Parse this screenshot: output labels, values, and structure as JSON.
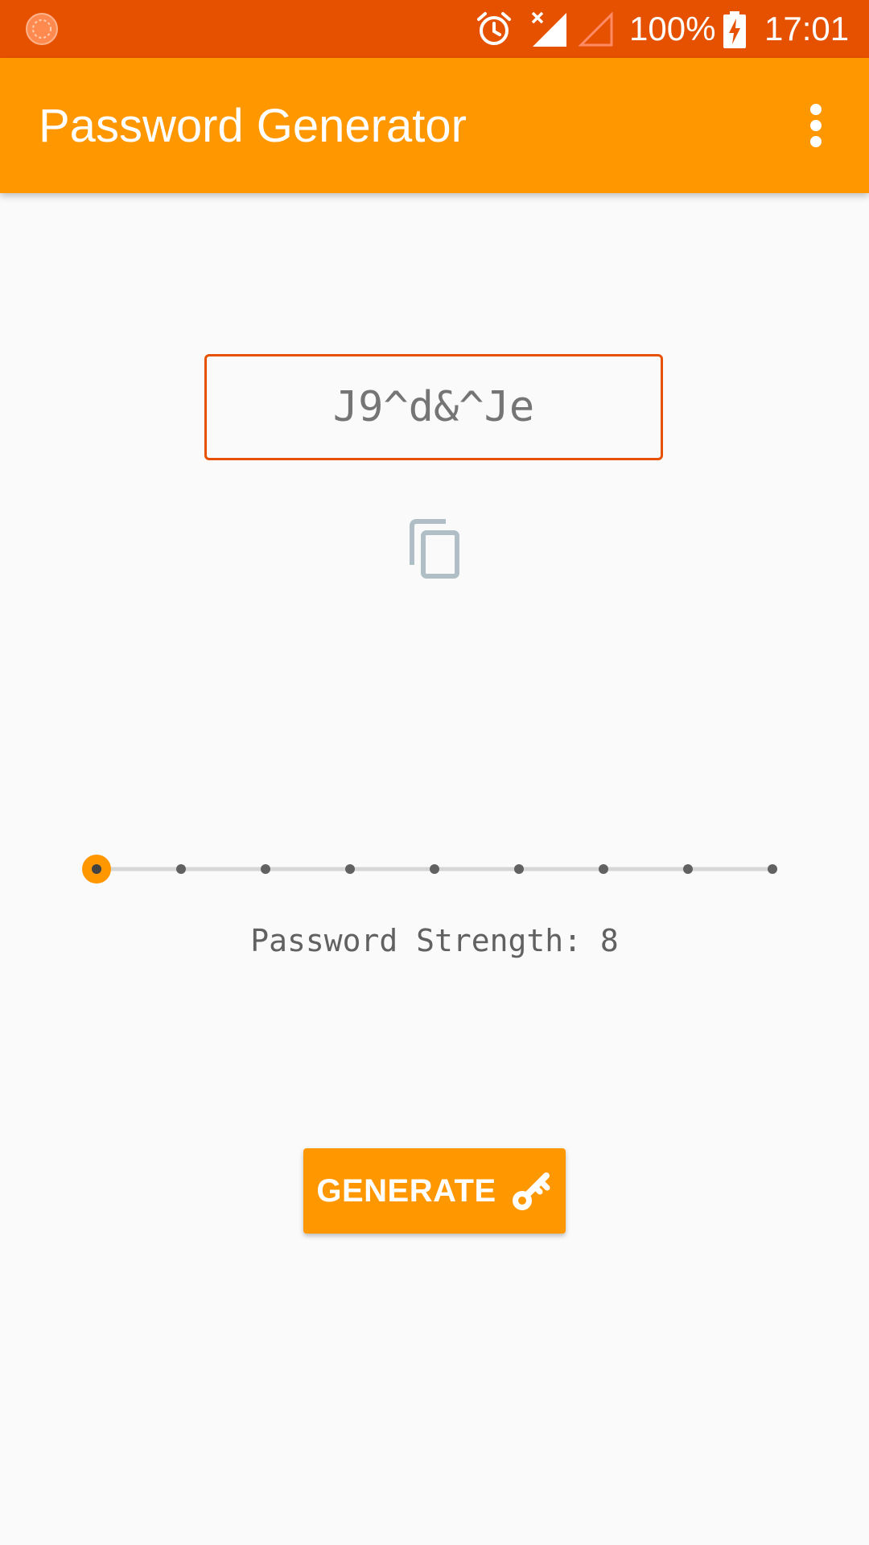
{
  "status_bar": {
    "battery_percent": "100%",
    "time": "17:01",
    "icons": [
      "notification-icon",
      "alarm-icon",
      "signal-no-service-icon",
      "signal-empty-icon",
      "battery-charging-icon"
    ]
  },
  "app_bar": {
    "title": "Password Generator",
    "overflow_icon": "more-vert-icon"
  },
  "password": {
    "value": "J9^d&^Je",
    "copy_icon": "copy-icon"
  },
  "strength_slider": {
    "min": 8,
    "max": 16,
    "value": 8,
    "steps": 9,
    "accent_color": "#FF9800"
  },
  "strength_label": "Password Strength: 8",
  "generate_button": {
    "label": "GENERATE",
    "icon": "key-icon"
  },
  "colors": {
    "status_bar": "#E65100",
    "app_bar": "#FF9800",
    "accent": "#FF9800",
    "field_border": "#E65100",
    "background": "#FAFAFA"
  }
}
